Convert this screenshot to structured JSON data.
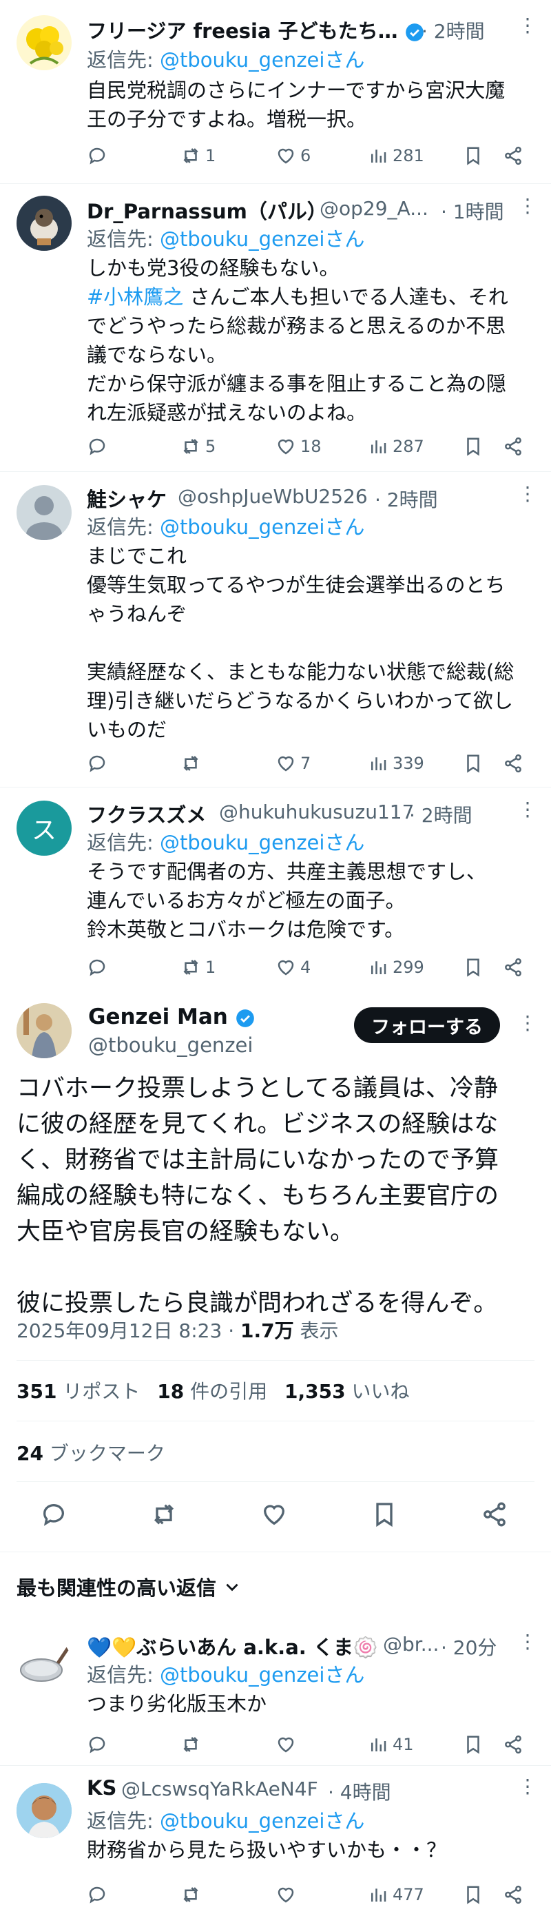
{
  "replies_top": [
    {
      "name": "フリージア freesia 子どもたち…",
      "handle": "",
      "time": "· 2時間",
      "reply_label": "返信先: ",
      "reply_to": "@tbouku_genzeiさん",
      "text": "自民党税調のさらにインナーですから宮沢大魔\n王の子分ですよね。増税一択。",
      "replies": "",
      "reposts": "1",
      "likes": "6",
      "views": "281"
    },
    {
      "name": "Dr_Parnassum（パル）",
      "handle": "@op29_A...",
      "time": "· 1時間",
      "reply_label": "返信先: ",
      "reply_to": "@tbouku_genzeiさん",
      "text_1": "しかも党3役の経験もない。",
      "hashtag": "#小林鷹之",
      "text_2": " さんご本人も担いでる人達も、それ\nでどうやったら総裁が務まると思えるのか不思\n議でならない。\nだから保守派が纏まる事を阻止すること為の隠\nれ左派疑惑が拭えないのよね。",
      "replies": "",
      "reposts": "5",
      "likes": "18",
      "views": "287"
    },
    {
      "name": "鮭シャケ",
      "handle": "@oshpJueWbU2526",
      "time": "· 2時間",
      "reply_label": "返信先: ",
      "reply_to": "@tbouku_genzeiさん",
      "text": "まじでこれ\n優等生気取ってるやつが生徒会選挙出るのとち\nゃうねんぞ\n\n実績経歴なく、まともな能力ない状態で総裁(総\n理)引き継いだらどうなるかくらいわかって欲し\nいものだ",
      "replies": "",
      "reposts": "",
      "likes": "7",
      "views": "339"
    },
    {
      "name": "フクラスズメ",
      "handle": "@hukuhukusuzu117",
      "time": "· 2時間",
      "avatar_letter": "ス",
      "reply_label": "返信先: ",
      "reply_to": "@tbouku_genzeiさん",
      "text": "そうです配偶者の方、共産主義思想ですし、\n連んでいるお方々がど極左の面子。\n鈴木英敬とコバホークは危険です。",
      "replies": "",
      "reposts": "1",
      "likes": "4",
      "views": "299"
    }
  ],
  "main_post": {
    "name": "Genzei Man",
    "handle": "@tbouku_genzei",
    "follow_label": "フォローする",
    "text": "コバホーク投票しようとしてる議員は、冷静\nに彼の経歴を見てくれ。ビジネスの経験はな\nく、財務省では主計局にいなかったので予算\n編成の経験も特になく、もちろん主要官庁の\n大臣や官房長官の経験もない。\n\n彼に投票したら良識が問われざるを得んぞ。",
    "timestamp": "2025年09月12日 8:23 · ",
    "views_count": "1.7万",
    "views_label": " 表示",
    "reposts_count": "351",
    "reposts_label": " リポスト",
    "quotes_count": "18",
    "quotes_label": " 件の引用",
    "likes_count": "1,353",
    "likes_label": " いいね",
    "bookmarks_count": "24",
    "bookmarks_label": " ブックマーク"
  },
  "sort_label": "最も関連性の高い返信",
  "replies_bottom": [
    {
      "name": "💙💛ぶらいあん a.k.a. くま🍥",
      "handle": "@br...",
      "time": "· 20分",
      "reply_label": "返信先: ",
      "reply_to": "@tbouku_genzeiさん",
      "text": "つまり劣化版玉木か",
      "replies": "",
      "reposts": "",
      "likes": "",
      "views": "41"
    },
    {
      "name": "KS",
      "handle": "@LcswsqYaRkAeN4F",
      "time": "· 4時間",
      "reply_label": "返信先: ",
      "reply_to": "@tbouku_genzeiさん",
      "text": "財務省から見たら扱いやすいかも・・？",
      "replies": "",
      "reposts": "",
      "likes": "",
      "views": "477"
    }
  ],
  "colors": {
    "accent": "#1d9bf0",
    "text": "#0f1419",
    "secondary": "#536471",
    "divider": "#eff3f4",
    "follow_bg": "#0f1419"
  }
}
